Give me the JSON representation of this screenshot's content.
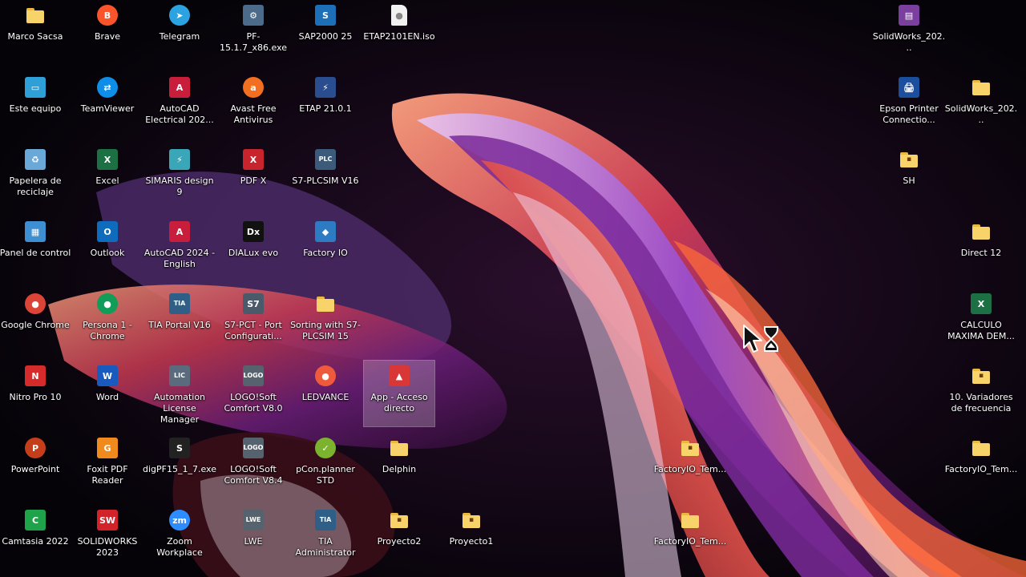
{
  "desktop": {
    "icons": [
      {
        "label": "Marco Sacsa",
        "icon": "folder-icon",
        "kind": "folder",
        "color": "#f7d36a"
      },
      {
        "label": "Brave",
        "icon": "brave-icon",
        "kind": "round",
        "glyph": "B",
        "color": "#fb542b"
      },
      {
        "label": "Telegram",
        "icon": "telegram-icon",
        "kind": "round",
        "glyph": "➤",
        "color": "#2aa3e0"
      },
      {
        "label": "PF-15.1.7_x86.exe",
        "icon": "installer-icon",
        "kind": "box",
        "glyph": "⚙",
        "color": "#4c6b8a"
      },
      {
        "label": "SAP2000 25",
        "icon": "sap2000-icon",
        "kind": "box",
        "glyph": "S",
        "color": "#1d6fb8"
      },
      {
        "label": "ETAP2101EN.iso",
        "icon": "disc-image-icon",
        "kind": "file",
        "glyph": "●",
        "color": "#f1f1f1"
      },
      {
        "label": "Este equipo",
        "icon": "computer-icon",
        "kind": "box",
        "glyph": "▭",
        "color": "#2f9fd8"
      },
      {
        "label": "TeamViewer",
        "icon": "teamviewer-icon",
        "kind": "round",
        "glyph": "⇄",
        "color": "#0e8ee9"
      },
      {
        "label": "AutoCAD Electrical 202...",
        "icon": "autocad-electrical-icon",
        "kind": "box",
        "glyph": "A",
        "color": "#c81d3b"
      },
      {
        "label": "Avast Free Antivirus",
        "icon": "avast-icon",
        "kind": "round",
        "glyph": "a",
        "color": "#f26f21"
      },
      {
        "label": "ETAP 21.0.1",
        "icon": "etap-icon",
        "kind": "box",
        "glyph": "⚡",
        "color": "#2a4d8f"
      },
      {
        "label": "Papelera de reciclaje",
        "icon": "recycle-bin-icon",
        "kind": "box",
        "glyph": "♻",
        "color": "#6aa8d8"
      },
      {
        "label": "Excel",
        "icon": "excel-icon",
        "kind": "box",
        "glyph": "X",
        "color": "#1d7044"
      },
      {
        "label": "SIMARIS design 9",
        "icon": "simaris-icon",
        "kind": "box",
        "glyph": "⚡",
        "color": "#3aa7b8"
      },
      {
        "label": "PDF X",
        "icon": "pdf-x-icon",
        "kind": "box",
        "glyph": "X",
        "color": "#c8242e"
      },
      {
        "label": "S7-PLCSIM V16",
        "icon": "plcsim-icon",
        "kind": "box",
        "glyph": "PLC",
        "color": "#3c5a7a"
      },
      {
        "label": "Panel de control",
        "icon": "control-panel-icon",
        "kind": "box",
        "glyph": "▦",
        "color": "#3d8fd1"
      },
      {
        "label": "Outlook",
        "icon": "outlook-icon",
        "kind": "box",
        "glyph": "O",
        "color": "#0f6cbd"
      },
      {
        "label": "AutoCAD 2024 - English",
        "icon": "autocad-icon",
        "kind": "box",
        "glyph": "A",
        "color": "#c81d3b"
      },
      {
        "label": "DIALux evo",
        "icon": "dialux-icon",
        "kind": "box",
        "glyph": "Dx",
        "color": "#111111"
      },
      {
        "label": "Factory IO",
        "icon": "factory-io-icon",
        "kind": "box",
        "glyph": "◆",
        "color": "#2d7cc3"
      },
      {
        "label": "Google Chrome",
        "icon": "chrome-icon",
        "kind": "round",
        "glyph": "●",
        "color": "#db4437"
      },
      {
        "label": "Persona 1 - Chrome",
        "icon": "chrome-profile-icon",
        "kind": "round",
        "glyph": "●",
        "color": "#0f9d58"
      },
      {
        "label": "TIA Portal V16",
        "icon": "tia-portal-icon",
        "kind": "box",
        "glyph": "TIA",
        "color": "#2f5f86"
      },
      {
        "label": "S7-PCT - Port Configurati...",
        "icon": "s7-pct-icon",
        "kind": "box",
        "glyph": "S7",
        "color": "#4a5a6a"
      },
      {
        "label": "Sorting with S7-PLCSIM 15",
        "icon": "folder-icon",
        "kind": "folder",
        "color": "#f7d36a"
      },
      {
        "label": "Nitro Pro 10",
        "icon": "nitro-icon",
        "kind": "box",
        "glyph": "N",
        "color": "#d62b2b"
      },
      {
        "label": "Word",
        "icon": "word-icon",
        "kind": "box",
        "glyph": "W",
        "color": "#185abd"
      },
      {
        "label": "Automation License Manager",
        "icon": "license-manager-icon",
        "kind": "box",
        "glyph": "LIC",
        "color": "#596b7d"
      },
      {
        "label": "LOGO!Soft Comfort V8.0",
        "icon": "logo-soft-icon",
        "kind": "box",
        "glyph": "LOGO",
        "color": "#56636f"
      },
      {
        "label": "LEDVANCE",
        "icon": "ledvance-icon",
        "kind": "round",
        "glyph": "●",
        "color": "#ef5a3c"
      },
      {
        "label": "App - Acceso directo",
        "icon": "app-shortcut-icon",
        "kind": "box",
        "glyph": "▲",
        "color": "#d93636",
        "selected": true
      },
      {
        "label": "PowerPoint",
        "icon": "powerpoint-icon",
        "kind": "round",
        "glyph": "P",
        "color": "#c43e1c"
      },
      {
        "label": "Foxit PDF Reader",
        "icon": "foxit-icon",
        "kind": "box",
        "glyph": "G",
        "color": "#f08a1c"
      },
      {
        "label": "digPF15_1_7.exe",
        "icon": "installer-icon",
        "kind": "box",
        "glyph": "S",
        "color": "#222222"
      },
      {
        "label": "LOGO!Soft Comfort V8.4",
        "icon": "logo-soft-icon",
        "kind": "box",
        "glyph": "LOGO",
        "color": "#56636f"
      },
      {
        "label": "pCon.planner STD",
        "icon": "pcon-icon",
        "kind": "round",
        "glyph": "✓",
        "color": "#7bb32e"
      },
      {
        "label": "Delphin",
        "icon": "folder-icon",
        "kind": "folder",
        "color": "#f7d36a"
      },
      {
        "label": "Camtasia 2022",
        "icon": "camtasia-icon",
        "kind": "box",
        "glyph": "C",
        "color": "#1fa34a"
      },
      {
        "label": "SOLIDWORKS 2023",
        "icon": "solidworks-icon",
        "kind": "box",
        "glyph": "SW",
        "color": "#d2232a"
      },
      {
        "label": "Zoom Workplace",
        "icon": "zoom-icon",
        "kind": "round",
        "glyph": "zm",
        "color": "#2d8cff"
      },
      {
        "label": "LWE",
        "icon": "lwe-icon",
        "kind": "box",
        "glyph": "LWE",
        "color": "#56636f"
      },
      {
        "label": "TIA Administrator",
        "icon": "tia-admin-icon",
        "kind": "box",
        "glyph": "TIA",
        "color": "#2f5f86"
      },
      {
        "label": "Proyecto2",
        "icon": "folder-icon",
        "kind": "folder",
        "color": "#f7d36a",
        "mark": "fio"
      },
      {
        "label": "Proyecto1",
        "icon": "folder-icon",
        "kind": "folder",
        "color": "#f7d36a",
        "mark": "fio"
      },
      {
        "label": "FactoryIO_Tem...",
        "icon": "folder-icon",
        "kind": "folder",
        "color": "#f7d36a",
        "mark": "fio"
      },
      {
        "label": "FactoryIO_Tem...",
        "icon": "folder-icon",
        "kind": "folder",
        "color": "#f7d36a"
      },
      {
        "label": "SolidWorks_202...",
        "icon": "winrar-icon",
        "kind": "box",
        "glyph": "▤",
        "color": "#7b3fa0"
      },
      {
        "label": "Epson Printer Connectio...",
        "icon": "epson-icon",
        "kind": "box",
        "glyph": "🖨",
        "color": "#1c4e9e"
      },
      {
        "label": "SolidWorks_202...",
        "icon": "folder-icon",
        "kind": "folder",
        "color": "#f7d36a"
      },
      {
        "label": "SH",
        "icon": "folder-icon",
        "kind": "folder",
        "color": "#f7d36a",
        "mark": "sh"
      },
      {
        "label": "Direct 12",
        "icon": "folder-icon",
        "kind": "folder",
        "color": "#f7d36a"
      },
      {
        "label": "CALCULO MAXIMA DEM...",
        "icon": "excel-file-icon",
        "kind": "box",
        "glyph": "X",
        "color": "#1d7044"
      },
      {
        "label": "10. Variadores de frecuencia",
        "icon": "folder-icon",
        "kind": "folder",
        "color": "#f7d36a",
        "mark": "pdf"
      },
      {
        "label": "FactoryIO_Tem...",
        "icon": "folder-icon",
        "kind": "folder",
        "color": "#f7d36a"
      }
    ]
  },
  "cursor": {
    "icon": "busy-cursor-icon"
  }
}
